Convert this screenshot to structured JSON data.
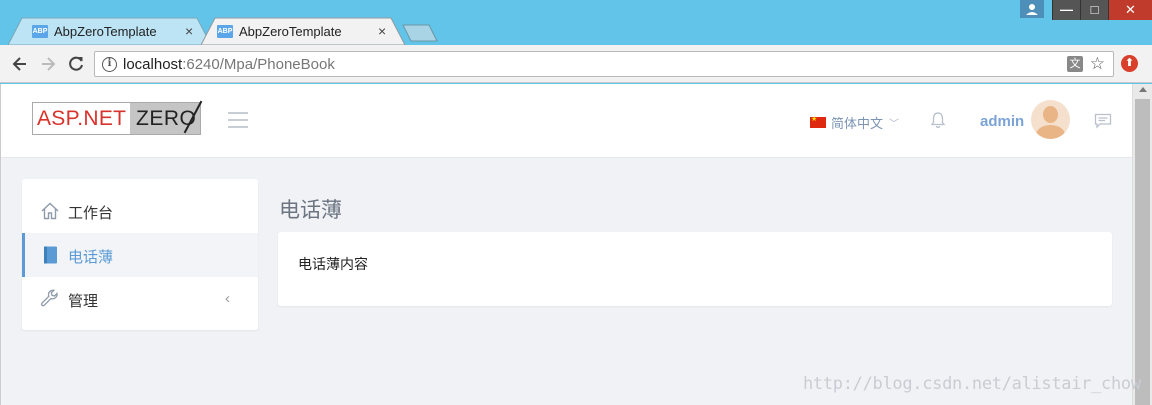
{
  "browser": {
    "tabs": [
      {
        "title": "AbpZeroTemplate",
        "favicon": "ABP",
        "active": false
      },
      {
        "title": "AbpZeroTemplate",
        "favicon": "ABP",
        "active": true
      }
    ],
    "tab_close_glyph": "×",
    "address": {
      "host": "localhost",
      "path": ":6240/Mpa/PhoneBook"
    },
    "window_buttons": {
      "minimize": "—",
      "maximize": "□",
      "close": "✕"
    }
  },
  "header": {
    "logo_left": "ASP.NET",
    "logo_right": "ZERO",
    "language": "简体中文",
    "username": "admin"
  },
  "sidebar": {
    "items": [
      {
        "label": "工作台",
        "icon": "home-icon",
        "active": false
      },
      {
        "label": "电话薄",
        "icon": "book-icon",
        "active": true
      },
      {
        "label": "管理",
        "icon": "wrench-icon",
        "active": false,
        "arrow": "‹"
      }
    ]
  },
  "main": {
    "title": "电话薄",
    "content": "电话薄内容"
  },
  "watermark": "http://blog.csdn.net/alistair_chow",
  "colors": {
    "accent": "#5b9bd5",
    "username": "#7ba3d6",
    "logo_red": "#d8322c",
    "page_bg": "#f0f2f6",
    "titlebar": "#62c4e8"
  }
}
